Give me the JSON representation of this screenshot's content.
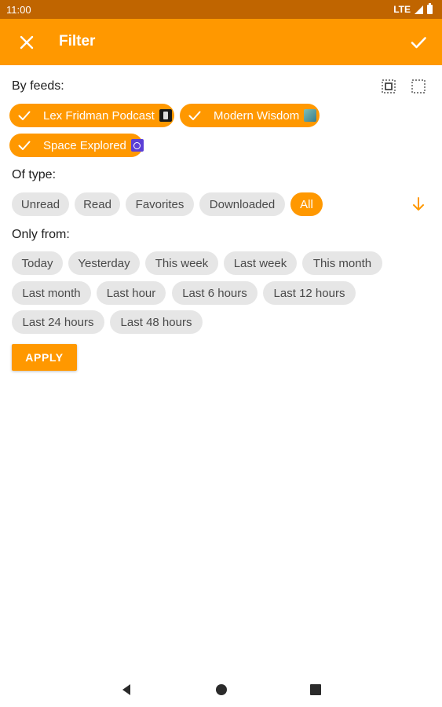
{
  "status_bar": {
    "time": "11:00",
    "network": "LTE"
  },
  "app_bar": {
    "title": "Filter"
  },
  "feeds": {
    "label": "By feeds:",
    "chips": [
      {
        "label": "Lex Fridman Podcast",
        "selected": true
      },
      {
        "label": "Modern Wisdom",
        "selected": true
      },
      {
        "label": "Space Explored",
        "selected": true
      }
    ]
  },
  "type": {
    "label": "Of type:",
    "options": [
      "Unread",
      "Read",
      "Favorites",
      "Downloaded",
      "All"
    ],
    "selected": "All"
  },
  "time_range": {
    "label": "Only from:",
    "options": [
      "Today",
      "Yesterday",
      "This week",
      "Last week",
      "This month",
      "Last month",
      "Last hour",
      "Last 6 hours",
      "Last 12 hours",
      "Last 24 hours",
      "Last 48 hours"
    ]
  },
  "apply_label": "APPLY",
  "colors": {
    "accent": "#ff9800",
    "status_bar": "#c06500",
    "chip_grey": "#e6e6e6"
  },
  "icons": {
    "close": "close-icon",
    "confirm": "check-icon",
    "select_all": "select-all-icon",
    "select_none": "select-none-icon",
    "sort": "arrow-down-icon"
  }
}
